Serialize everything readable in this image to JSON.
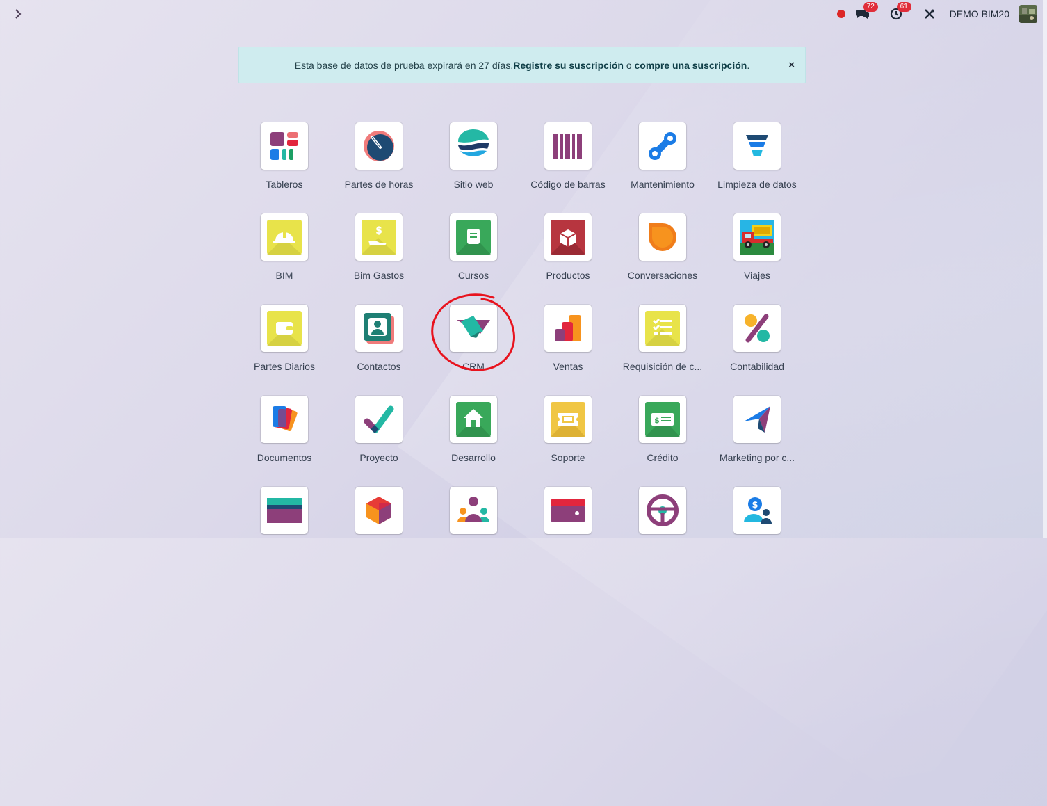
{
  "systray": {
    "messages_count": "72",
    "activities_count": "61",
    "company": "DEMO BIM20"
  },
  "banner": {
    "text_before": "Esta base de datos de prueba expirará en 27 días.",
    "register_link": "Registre su suscripción",
    "middle": " o ",
    "buy_link": "compre una suscripción",
    "text_after": ".",
    "close": "×"
  },
  "apps": [
    {
      "label": "Tableros",
      "icon": "dashboards-icon"
    },
    {
      "label": "Partes de horas",
      "icon": "timesheets-icon"
    },
    {
      "label": "Sitio web",
      "icon": "website-icon"
    },
    {
      "label": "Código de barras",
      "icon": "barcode-icon"
    },
    {
      "label": "Mantenimiento",
      "icon": "maintenance-icon"
    },
    {
      "label": "Limpieza de datos",
      "icon": "data-cleaning-icon"
    },
    {
      "label": "BIM",
      "icon": "helmet-icon"
    },
    {
      "label": "Bim Gastos",
      "icon": "expense-hand-icon"
    },
    {
      "label": "Cursos",
      "icon": "book-icon"
    },
    {
      "label": "Productos",
      "icon": "box-icon"
    },
    {
      "label": "Conversaciones",
      "icon": "chat-bubble-icon"
    },
    {
      "label": "Viajes",
      "icon": "truck-icon"
    },
    {
      "label": "Partes Diarios",
      "icon": "wallet-icon"
    },
    {
      "label": "Contactos",
      "icon": "contact-card-icon"
    },
    {
      "label": "CRM",
      "icon": "crm-handshake-icon"
    },
    {
      "label": "Ventas",
      "icon": "sales-chart-icon"
    },
    {
      "label": "Requisición de c...",
      "icon": "checklist-icon"
    },
    {
      "label": "Contabilidad",
      "icon": "accounting-icon"
    },
    {
      "label": "Documentos",
      "icon": "documents-icon"
    },
    {
      "label": "Proyecto",
      "icon": "project-check-icon"
    },
    {
      "label": "Desarrollo",
      "icon": "house-icon"
    },
    {
      "label": "Soporte",
      "icon": "ticket-icon"
    },
    {
      "label": "Crédito",
      "icon": "credit-bill-icon"
    },
    {
      "label": "Marketing por c...",
      "icon": "paper-plane-icon"
    },
    {
      "label": "",
      "icon": "card-stripes-icon"
    },
    {
      "label": "",
      "icon": "hexagon-icon"
    },
    {
      "label": "",
      "icon": "team-icon"
    },
    {
      "label": "",
      "icon": "wallet-pink-icon"
    },
    {
      "label": "",
      "icon": "steering-wheel-icon"
    },
    {
      "label": "",
      "icon": "payroll-icon"
    }
  ]
}
